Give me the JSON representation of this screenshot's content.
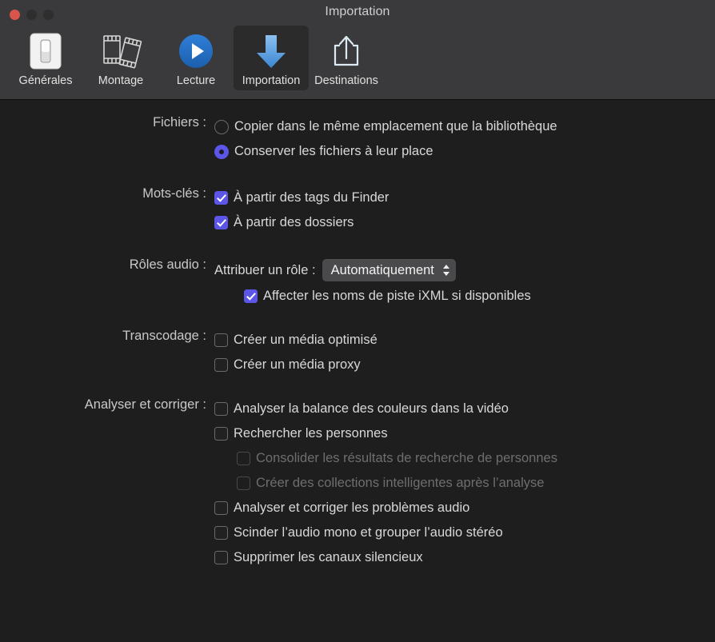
{
  "window": {
    "title": "Importation",
    "traffic_lights": [
      "close-button",
      "minimize-button",
      "maximize-button"
    ]
  },
  "toolbar": {
    "items": [
      {
        "label": "Générales",
        "icon": "general-switch-icon",
        "selected": false
      },
      {
        "label": "Montage",
        "icon": "film-strips-icon",
        "selected": false
      },
      {
        "label": "Lecture",
        "icon": "play-circle-icon",
        "selected": false
      },
      {
        "label": "Importation",
        "icon": "download-arrow-icon",
        "selected": true
      },
      {
        "label": "Destinations",
        "icon": "share-export-icon",
        "selected": false
      }
    ]
  },
  "sections": {
    "fichiers": {
      "label": "Fichiers :",
      "options": [
        {
          "text": "Copier dans le même emplacement que la bibliothèque",
          "selected": false
        },
        {
          "text": "Conserver les fichiers à leur place",
          "selected": true
        }
      ]
    },
    "mots_cles": {
      "label": "Mots-clés :",
      "options": [
        {
          "text": "À partir des tags du Finder",
          "checked": true,
          "disabled": false
        },
        {
          "text": "À partir des dossiers",
          "checked": true,
          "disabled": false
        }
      ]
    },
    "roles_audio": {
      "label": "Rôles audio :",
      "assign_label": "Attribuer un rôle :",
      "assign_value": "Automatiquement",
      "assign_options": [
        "Automatiquement"
      ],
      "options": [
        {
          "text": "Affecter les noms de piste iXML si disponibles",
          "checked": true,
          "disabled": false
        }
      ]
    },
    "transcodage": {
      "label": "Transcodage :",
      "options": [
        {
          "text": "Créer un média optimisé",
          "checked": false,
          "disabled": false
        },
        {
          "text": "Créer un média proxy",
          "checked": false,
          "disabled": false
        }
      ]
    },
    "analyser": {
      "label": "Analyser et corriger :",
      "options": [
        {
          "text": "Analyser la balance des couleurs dans la vidéo",
          "checked": false,
          "disabled": false,
          "sub": false
        },
        {
          "text": "Rechercher les personnes",
          "checked": false,
          "disabled": false,
          "sub": false
        },
        {
          "text": "Consolider les résultats de recherche de personnes",
          "checked": false,
          "disabled": true,
          "sub": true
        },
        {
          "text": "Créer des collections intelligentes après l’analyse",
          "checked": false,
          "disabled": true,
          "sub": true
        },
        {
          "text": "Analyser et corriger les problèmes audio",
          "checked": false,
          "disabled": false,
          "sub": false
        },
        {
          "text": "Scinder l’audio mono et grouper l’audio stéréo",
          "checked": false,
          "disabled": false,
          "sub": false
        },
        {
          "text": "Supprimer les canaux silencieux",
          "checked": false,
          "disabled": false,
          "sub": false
        }
      ]
    }
  },
  "colors": {
    "accent": "#5b56e8",
    "titlebar_bg": "#3a3a3c",
    "content_bg": "#1e1e1e",
    "selected_tab_bg": "#2b2b2b",
    "close_light": "#d9544d",
    "popup_bg": "#4a4a4c"
  }
}
